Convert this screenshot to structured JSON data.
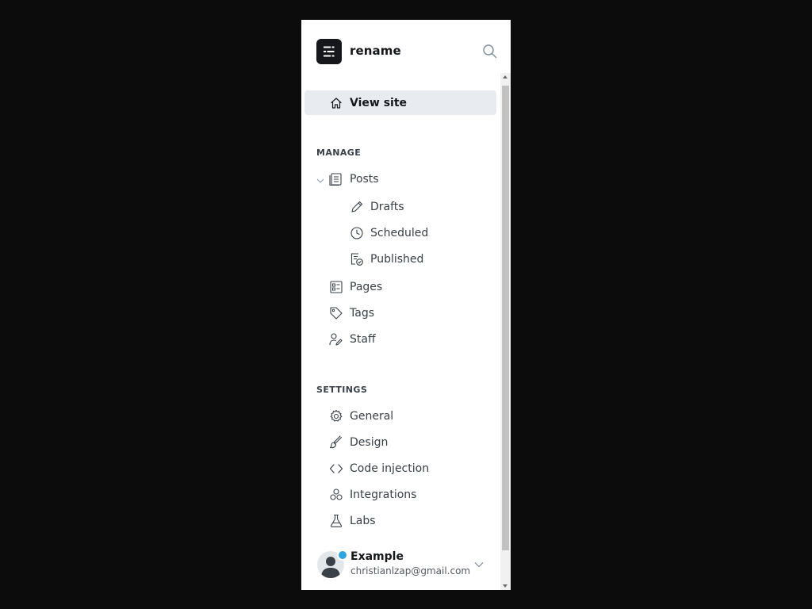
{
  "header": {
    "site_title": "rename"
  },
  "nav": {
    "view_site": "View site",
    "manage_heading": "MANAGE",
    "posts": "Posts",
    "drafts": "Drafts",
    "scheduled": "Scheduled",
    "published": "Published",
    "pages": "Pages",
    "tags": "Tags",
    "staff": "Staff",
    "settings_heading": "SETTINGS",
    "general": "General",
    "design": "Design",
    "code_injection": "Code injection",
    "integrations": "Integrations",
    "labs": "Labs"
  },
  "user": {
    "name": "Example",
    "email": "christianlzap@gmail.com",
    "status_color": "#30a5e0"
  },
  "icons": [
    "site-logo-icon",
    "search-icon",
    "home-icon",
    "chevron-down-icon",
    "posts-icon",
    "pencil-icon",
    "clock-icon",
    "published-icon",
    "pages-icon",
    "tag-icon",
    "staff-icon",
    "gear-icon",
    "brush-icon",
    "code-icon",
    "integrations-icon",
    "flask-icon",
    "avatar-icon"
  ],
  "colors": {
    "background": "#0c0c0c",
    "panel": "#ffffff",
    "active_item": "#e8ecf1",
    "text": "#394047"
  }
}
